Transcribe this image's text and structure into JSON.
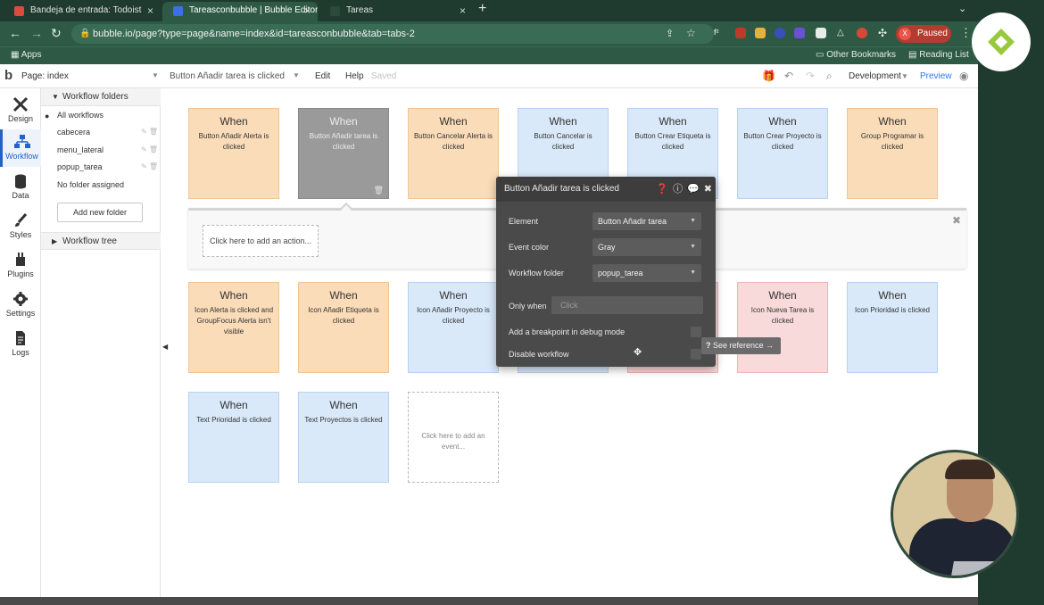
{
  "browser": {
    "tabs": [
      {
        "label": "Bandeja de entrada: Todoist",
        "favicon_color": "#db4c3f"
      },
      {
        "label": "Tareasconbubble | Bubble Editor",
        "favicon_color": "#3b6ee8"
      },
      {
        "label": "Tareas",
        "favicon_color": "#cccccc"
      }
    ],
    "url": "bubble.io/page?type=page&name=index&id=tareasconbubble&tab=tabs-2",
    "profile_initial": "X",
    "profile_status": "Paused",
    "bookmarks": {
      "apps": "Apps",
      "other": "Other Bookmarks",
      "reading": "Reading List"
    }
  },
  "editor": {
    "page_label": "Page: index",
    "workflow_selector": "Button Añadir tarea is clicked",
    "edit": "Edit",
    "help": "Help",
    "saved": "Saved",
    "environment": "Development",
    "preview": "Preview"
  },
  "rail": [
    {
      "label": "Design",
      "icon": "design-icon"
    },
    {
      "label": "Workflow",
      "icon": "workflow-icon"
    },
    {
      "label": "Data",
      "icon": "data-icon"
    },
    {
      "label": "Styles",
      "icon": "styles-icon"
    },
    {
      "label": "Plugins",
      "icon": "plugins-icon"
    },
    {
      "label": "Settings",
      "icon": "settings-icon"
    },
    {
      "label": "Logs",
      "icon": "logs-icon"
    }
  ],
  "folders": {
    "header": "Workflow folders",
    "all": "All workflows",
    "items": [
      "cabecera",
      "menu_lateral",
      "popup_tarea"
    ],
    "none": "No folder assigned",
    "add": "Add new folder",
    "tree": "Workflow tree"
  },
  "events": {
    "when": "When",
    "row1": [
      {
        "text": "Button Añadir Alerta is clicked",
        "color": "orange"
      },
      {
        "text": "Button Añadir tarea is clicked",
        "color": "gray"
      },
      {
        "text": "Button Cancelar Alerta is clicked",
        "color": "orange"
      },
      {
        "text": "Button Cancelar is clicked",
        "color": "blue"
      },
      {
        "text": "Button Crear Etiqueta is clicked",
        "color": "blue"
      },
      {
        "text": "Button Crear Proyecto is clicked",
        "color": "blue"
      },
      {
        "text": "Group Programar is clicked",
        "color": "orange"
      }
    ],
    "row2": [
      {
        "text": "Icon Alerta is clicked and GroupFocus Alerta isn't visible",
        "color": "orange"
      },
      {
        "text": "Icon Añadir Etiqueta is clicked",
        "color": "orange"
      },
      {
        "text": "Icon Añadir Proyecto is clicked",
        "color": "blue"
      },
      {
        "text": "Icon Nueva Tarea is clicked",
        "color": "pink"
      },
      {
        "text": "Icon Prioridad is clicked",
        "color": "blue"
      }
    ],
    "row3": [
      {
        "text": "Text Prioridad is clicked",
        "color": "blue"
      },
      {
        "text": "Text Proyectos is clicked",
        "color": "blue"
      }
    ],
    "add_event": "Click here to add an event..."
  },
  "action_panel": {
    "add_action": "Click here to add an action..."
  },
  "property_editor": {
    "title": "Button Añadir tarea is clicked",
    "element_label": "Element",
    "element_value": "Button Añadir tarea",
    "color_label": "Event color",
    "color_value": "Gray",
    "folder_label": "Workflow folder",
    "folder_value": "popup_tarea",
    "only_when_label": "Only when",
    "only_when_placeholder": "Click",
    "breakpoint_label": "Add a breakpoint in debug mode",
    "disable_label": "Disable workflow",
    "see_reference": "See reference →"
  },
  "colors": {
    "orange": "#fbdcb8",
    "blue": "#d9e9f9",
    "pink": "#f9dada",
    "gray": "#9a9a9a",
    "chrome_green": "#2e5a45",
    "accent_blue": "#2363c8"
  }
}
